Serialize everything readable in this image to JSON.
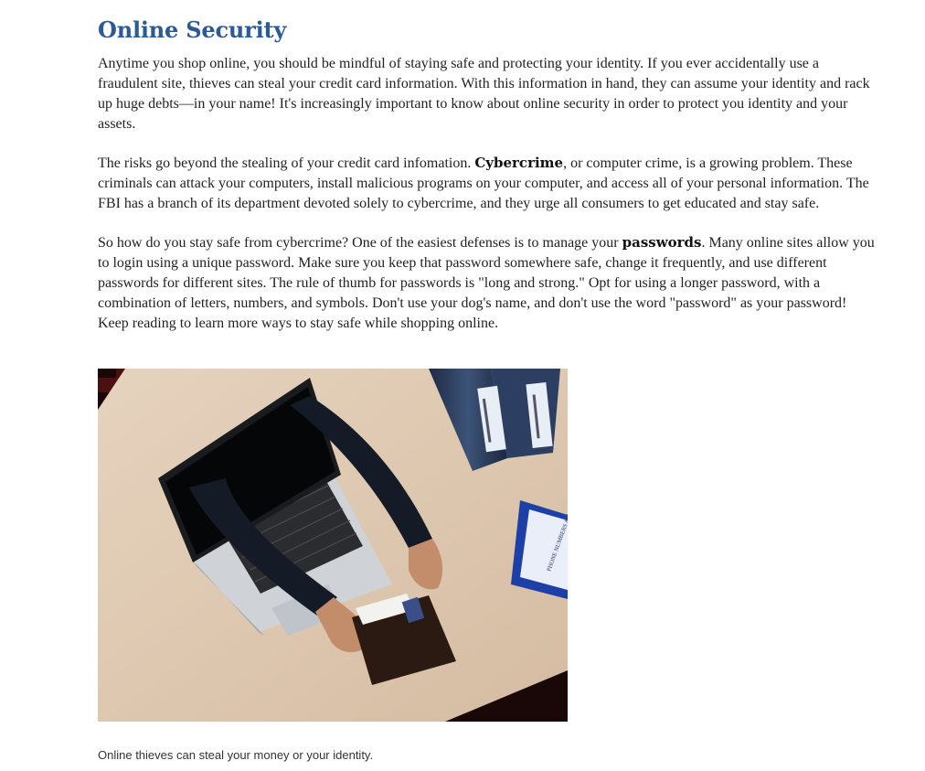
{
  "article": {
    "title": "Online Security",
    "paragraphs": [
      {
        "before": "Anytime you shop online, you should be mindful of staying safe and protecting your identity. If you ever accidentally use a fraudulent site, thieves can steal your credit card information. With this information in hand, they can assume your identity and rack up huge debts—in your name! It's increasingly important to know about online security in order to protect you identity and your assets.",
        "bold": "",
        "after": ""
      },
      {
        "before": "The risks go beyond the stealing of your credit card infomation. ",
        "bold": "Cybercrime",
        "after": ", or computer crime, is a growing problem. These criminals can attack your computers, install malicious programs on your computer, and access all of your personal information. The FBI has a branch of its department devoted solely to cybercrime, and they urge all consumers to get educated and stay safe."
      },
      {
        "before": "So how do you stay safe from cybercrime? One of the easiest defenses is to manage your ",
        "bold": "passwords",
        "after": ". Many online sites allow you to login using a unique password. Make sure you keep that password somewhere safe, change it frequently, and use different passwords for different sites. The rule of thumb for passwords is \"long and strong.\" Opt for using a longer password, with a combination of letters, numbers, and symbols. Don't use your dog's name, and don't use the word \"password\" as your password! Keep reading to learn more ways to stay safe while shopping online."
      }
    ],
    "figure": {
      "book_label": "PHONE NUMBERS & ADDRESSES",
      "caption": "Online thieves can steal your money or your identity."
    }
  }
}
